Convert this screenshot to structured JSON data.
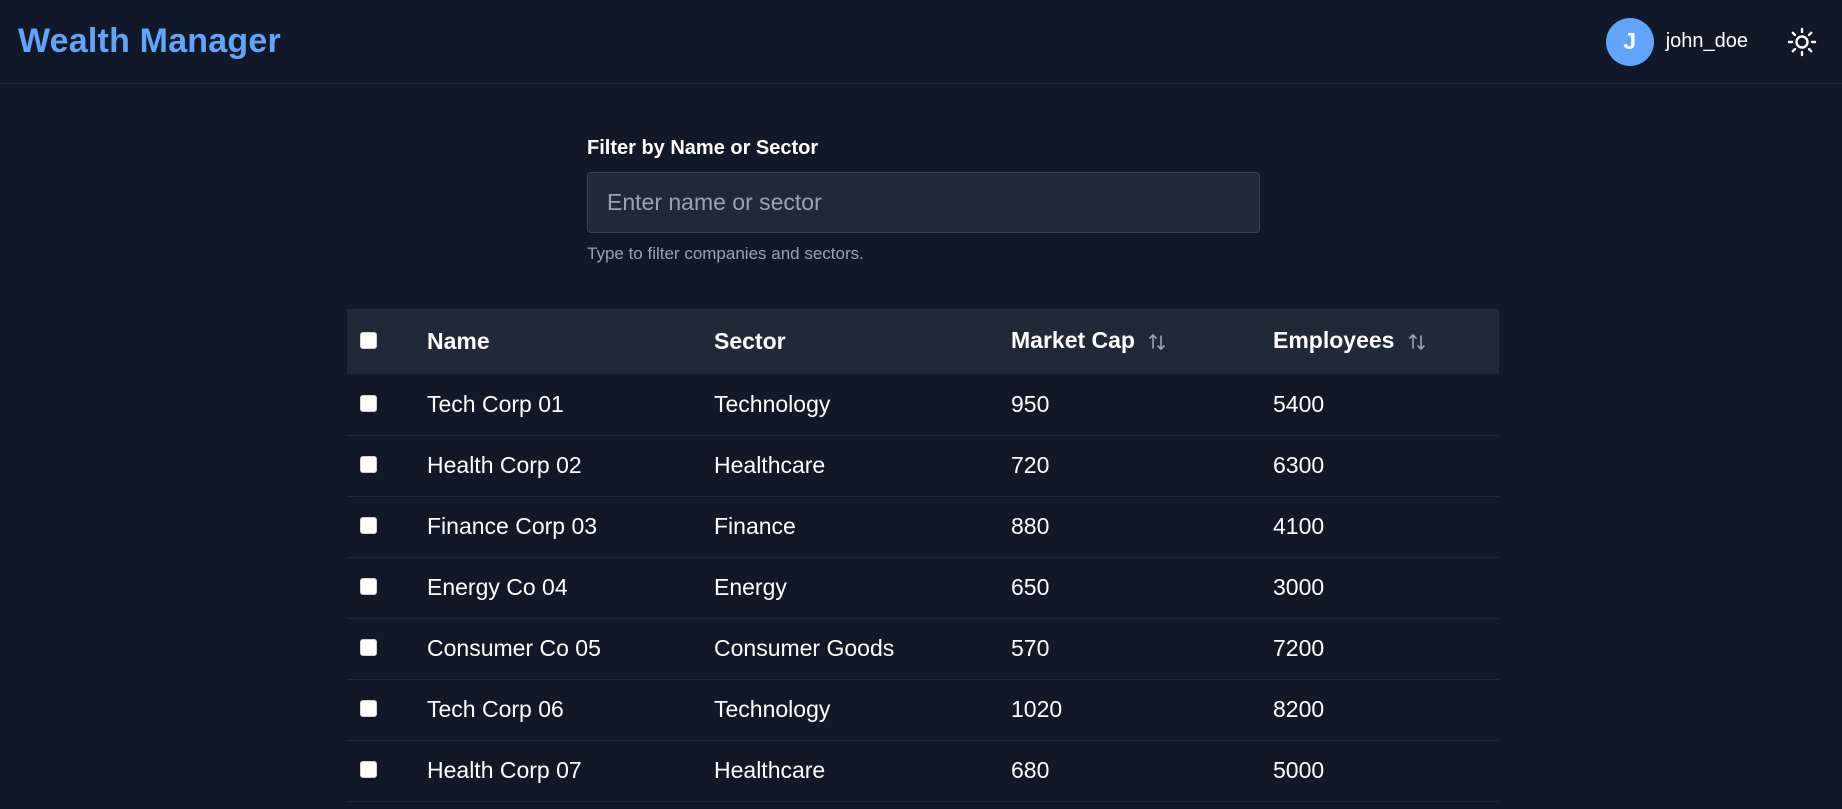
{
  "header": {
    "title": "Wealth Manager",
    "user": {
      "initial": "J",
      "username": "john_doe"
    },
    "theme_icon": "sun-icon"
  },
  "filter": {
    "label": "Filter by Name or Sector",
    "placeholder": "Enter name or sector",
    "value": "",
    "help": "Type to filter companies and sectors."
  },
  "table": {
    "columns": [
      "Name",
      "Sector",
      "Market Cap",
      "Employees"
    ],
    "sortable": [
      "Market Cap",
      "Employees"
    ],
    "rows": [
      {
        "name": "Tech Corp 01",
        "sector": "Technology",
        "market_cap": "950",
        "employees": "5400"
      },
      {
        "name": "Health Corp 02",
        "sector": "Healthcare",
        "market_cap": "720",
        "employees": "6300"
      },
      {
        "name": "Finance Corp 03",
        "sector": "Finance",
        "market_cap": "880",
        "employees": "4100"
      },
      {
        "name": "Energy Co 04",
        "sector": "Energy",
        "market_cap": "650",
        "employees": "3000"
      },
      {
        "name": "Consumer Co 05",
        "sector": "Consumer Goods",
        "market_cap": "570",
        "employees": "7200"
      },
      {
        "name": "Tech Corp 06",
        "sector": "Technology",
        "market_cap": "1020",
        "employees": "8200"
      },
      {
        "name": "Health Corp 07",
        "sector": "Healthcare",
        "market_cap": "680",
        "employees": "5000"
      }
    ]
  },
  "colors": {
    "background": "#111827",
    "surface": "#1f2937",
    "accent": "#60a5fa",
    "muted_text": "#9ca3af"
  }
}
